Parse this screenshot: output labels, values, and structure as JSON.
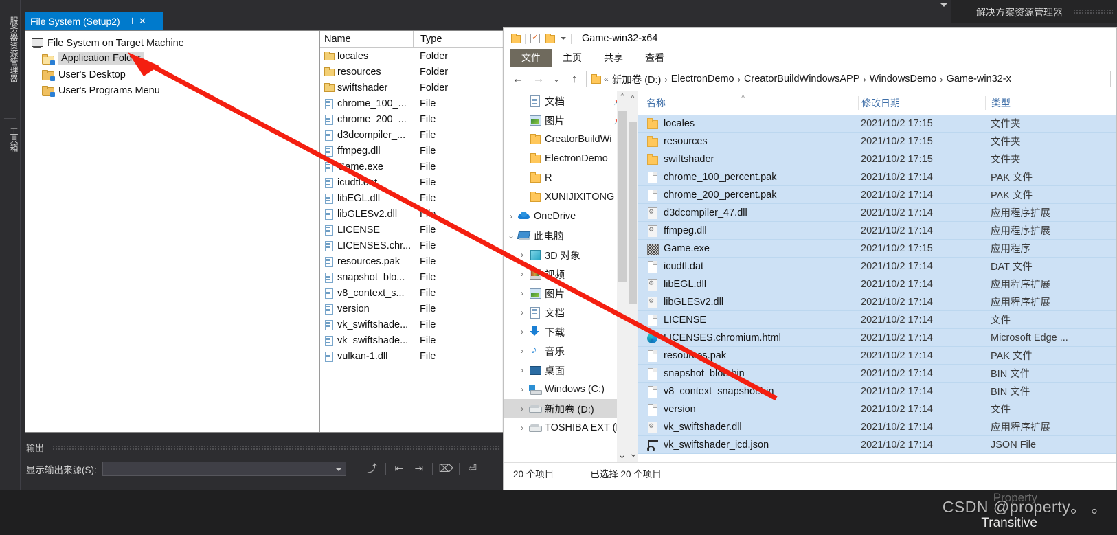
{
  "vs": {
    "rail_labels": [
      "服务器资源管理器",
      "工具箱"
    ],
    "solution_explorer_tab": "解决方案资源管理器",
    "document_tab": {
      "title": "File System (Setup2)",
      "pin_icon": "pin-icon",
      "close_icon": "close-icon"
    },
    "tree": [
      {
        "label": "File System on Target Machine",
        "icon": "machine-icon",
        "selected": false,
        "indent": false
      },
      {
        "label": "Application Folder",
        "icon": "folder-open-icon",
        "selected": true,
        "indent": true
      },
      {
        "label": "User's Desktop",
        "icon": "folder-icon",
        "selected": false,
        "indent": true
      },
      {
        "label": "User's Programs Menu",
        "icon": "folder-icon",
        "selected": false,
        "indent": true
      }
    ],
    "list_headers": {
      "name": "Name",
      "type": "Type"
    },
    "list_rows": [
      {
        "name": "locales",
        "type": "Folder",
        "icon": "folder-icon"
      },
      {
        "name": "resources",
        "type": "Folder",
        "icon": "folder-icon"
      },
      {
        "name": "swiftshader",
        "type": "Folder",
        "icon": "folder-icon"
      },
      {
        "name": "chrome_100_...",
        "type": "File",
        "icon": "file-icon"
      },
      {
        "name": "chrome_200_...",
        "type": "File",
        "icon": "file-icon"
      },
      {
        "name": "d3dcompiler_...",
        "type": "File",
        "icon": "file-icon"
      },
      {
        "name": "ffmpeg.dll",
        "type": "File",
        "icon": "file-icon"
      },
      {
        "name": "Game.exe",
        "type": "File",
        "icon": "file-icon"
      },
      {
        "name": "icudtl.dat",
        "type": "File",
        "icon": "file-icon"
      },
      {
        "name": "libEGL.dll",
        "type": "File",
        "icon": "file-icon"
      },
      {
        "name": "libGLESv2.dll",
        "type": "File",
        "icon": "file-icon"
      },
      {
        "name": "LICENSE",
        "type": "File",
        "icon": "file-icon"
      },
      {
        "name": "LICENSES.chr...",
        "type": "File",
        "icon": "file-icon"
      },
      {
        "name": "resources.pak",
        "type": "File",
        "icon": "file-icon"
      },
      {
        "name": "snapshot_blo...",
        "type": "File",
        "icon": "file-icon"
      },
      {
        "name": "v8_context_s...",
        "type": "File",
        "icon": "file-icon"
      },
      {
        "name": "version",
        "type": "File",
        "icon": "file-icon"
      },
      {
        "name": "vk_swiftshade...",
        "type": "File",
        "icon": "file-icon"
      },
      {
        "name": "vk_swiftshade...",
        "type": "File",
        "icon": "file-icon"
      },
      {
        "name": "vulkan-1.dll",
        "type": "File",
        "icon": "file-icon"
      }
    ],
    "output": {
      "panel_title": "输出",
      "source_label": "显示输出来源(S):",
      "source_value": "",
      "tools": [
        "jump-to-icon",
        "outdent-icon",
        "indent-icon",
        "clear-icon",
        "wrap-icon"
      ]
    }
  },
  "explorer": {
    "title": "Game-win32-x64",
    "quick_access": [
      "folder-icon",
      "properties-check-icon",
      "new-folder-icon",
      "customize-caret-icon"
    ],
    "ribbon_tabs": [
      {
        "label": "文件",
        "active": true
      },
      {
        "label": "主页",
        "active": false
      },
      {
        "label": "共享",
        "active": false
      },
      {
        "label": "查看",
        "active": false
      }
    ],
    "nav": {
      "back_icon": "arrow-left-icon",
      "forward_icon": "arrow-right-icon",
      "recent_icon": "chevron-down-icon",
      "up_icon": "arrow-up-icon"
    },
    "breadcrumb": {
      "overflow": "«",
      "items": [
        "新加卷 (D:)",
        "ElectronDemo",
        "CreatorBuildWindowsAPP",
        "WindowsDemo",
        "Game-win32-x"
      ]
    },
    "sidebar": [
      {
        "label": "文档",
        "icon": "documents-icon",
        "expander": "",
        "pin": "pin-icon",
        "indent": 1,
        "selected": false
      },
      {
        "label": "图片",
        "icon": "pictures-icon",
        "expander": "",
        "pin": "pin-icon",
        "indent": 1,
        "selected": false
      },
      {
        "label": "CreatorBuildWi",
        "icon": "folder-icon",
        "expander": "",
        "pin": "",
        "indent": 1,
        "selected": false
      },
      {
        "label": "ElectronDemo",
        "icon": "folder-icon",
        "expander": "",
        "pin": "",
        "indent": 1,
        "selected": false
      },
      {
        "label": "R",
        "icon": "folder-icon",
        "expander": "",
        "pin": "",
        "indent": 1,
        "selected": false
      },
      {
        "label": "XUNIJIXITONG",
        "icon": "folder-icon",
        "expander": "",
        "pin": "",
        "indent": 1,
        "selected": false
      },
      {
        "label": "OneDrive",
        "icon": "onedrive-icon",
        "expander": "›",
        "pin": "",
        "indent": 0,
        "selected": false
      },
      {
        "label": "此电脑",
        "icon": "this-pc-icon",
        "expander": "⌄",
        "pin": "",
        "indent": 0,
        "selected": false
      },
      {
        "label": "3D 对象",
        "icon": "3d-objects-icon",
        "expander": "›",
        "pin": "",
        "indent": 1,
        "selected": false
      },
      {
        "label": "视频",
        "icon": "videos-icon",
        "expander": "›",
        "pin": "",
        "indent": 1,
        "selected": false
      },
      {
        "label": "图片",
        "icon": "pictures-icon",
        "expander": "›",
        "pin": "",
        "indent": 1,
        "selected": false
      },
      {
        "label": "文档",
        "icon": "documents-icon",
        "expander": "›",
        "pin": "",
        "indent": 1,
        "selected": false
      },
      {
        "label": "下载",
        "icon": "downloads-icon",
        "expander": "›",
        "pin": "",
        "indent": 1,
        "selected": false
      },
      {
        "label": "音乐",
        "icon": "music-icon",
        "expander": "›",
        "pin": "",
        "indent": 1,
        "selected": false
      },
      {
        "label": "桌面",
        "icon": "desktop-icon",
        "expander": "›",
        "pin": "",
        "indent": 1,
        "selected": false
      },
      {
        "label": "Windows (C:)",
        "icon": "windows-drive-icon",
        "expander": "›",
        "pin": "",
        "indent": 1,
        "selected": false
      },
      {
        "label": "新加卷 (D:)",
        "icon": "drive-icon",
        "expander": "›",
        "pin": "",
        "indent": 1,
        "selected": true
      },
      {
        "label": "TOSHIBA EXT (I",
        "icon": "drive-icon",
        "expander": "›",
        "pin": "",
        "indent": 1,
        "selected": false
      }
    ],
    "columns": {
      "name": "名称",
      "date": "修改日期",
      "type": "类型"
    },
    "files": [
      {
        "name": "locales",
        "date": "2021/10/2 17:15",
        "type": "文件夹",
        "icon": "folder-icon"
      },
      {
        "name": "resources",
        "date": "2021/10/2 17:15",
        "type": "文件夹",
        "icon": "folder-icon"
      },
      {
        "name": "swiftshader",
        "date": "2021/10/2 17:15",
        "type": "文件夹",
        "icon": "folder-icon"
      },
      {
        "name": "chrome_100_percent.pak",
        "date": "2021/10/2 17:14",
        "type": "PAK 文件",
        "icon": "blank-file-icon"
      },
      {
        "name": "chrome_200_percent.pak",
        "date": "2021/10/2 17:14",
        "type": "PAK 文件",
        "icon": "blank-file-icon"
      },
      {
        "name": "d3dcompiler_47.dll",
        "date": "2021/10/2 17:14",
        "type": "应用程序扩展",
        "icon": "dll-file-icon"
      },
      {
        "name": "ffmpeg.dll",
        "date": "2021/10/2 17:14",
        "type": "应用程序扩展",
        "icon": "dll-file-icon"
      },
      {
        "name": "Game.exe",
        "date": "2021/10/2 17:15",
        "type": "应用程序",
        "icon": "exe-file-icon"
      },
      {
        "name": "icudtl.dat",
        "date": "2021/10/2 17:14",
        "type": "DAT 文件",
        "icon": "blank-file-icon"
      },
      {
        "name": "libEGL.dll",
        "date": "2021/10/2 17:14",
        "type": "应用程序扩展",
        "icon": "dll-file-icon"
      },
      {
        "name": "libGLESv2.dll",
        "date": "2021/10/2 17:14",
        "type": "应用程序扩展",
        "icon": "dll-file-icon"
      },
      {
        "name": "LICENSE",
        "date": "2021/10/2 17:14",
        "type": "文件",
        "icon": "blank-file-icon"
      },
      {
        "name": "LICENSES.chromium.html",
        "date": "2021/10/2 17:14",
        "type": "Microsoft Edge ...",
        "icon": "edge-file-icon"
      },
      {
        "name": "resources.pak",
        "date": "2021/10/2 17:14",
        "type": "PAK 文件",
        "icon": "blank-file-icon"
      },
      {
        "name": "snapshot_blob.bin",
        "date": "2021/10/2 17:14",
        "type": "BIN 文件",
        "icon": "blank-file-icon"
      },
      {
        "name": "v8_context_snapshot.bin",
        "date": "2021/10/2 17:14",
        "type": "BIN 文件",
        "icon": "blank-file-icon"
      },
      {
        "name": "version",
        "date": "2021/10/2 17:14",
        "type": "文件",
        "icon": "blank-file-icon"
      },
      {
        "name": "vk_swiftshader.dll",
        "date": "2021/10/2 17:14",
        "type": "应用程序扩展",
        "icon": "dll-file-icon"
      },
      {
        "name": "vk_swiftshader_icd.json",
        "date": "2021/10/2 17:14",
        "type": "JSON File",
        "icon": "json-file-icon"
      }
    ],
    "status": {
      "item_count": "20 个项目",
      "selection": "已选择 20 个项目"
    }
  },
  "watermark": {
    "csdn": "CSDN @property。 。",
    "property": "Property",
    "transitive": "Transitive"
  },
  "annotation": {
    "arrow_color": "#f41f10"
  }
}
